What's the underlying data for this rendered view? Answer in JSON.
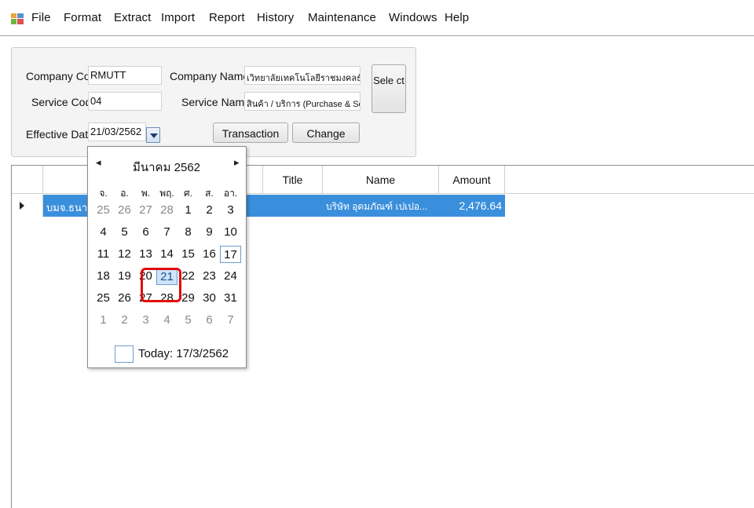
{
  "menu": {
    "items": [
      "File",
      "Format",
      "Extract",
      "Import",
      "Report",
      "History",
      "Maintenance",
      "Windows",
      "Help"
    ]
  },
  "header_panel": {
    "company_code_label": "Company Code",
    "company_code_value": "RMUTT",
    "company_name_label": "Company Name:",
    "company_name_value": "เวิทยาลัยเทคโนโลยีราชมงคลธัญบุรี",
    "service_code_label": "Service Code",
    "service_code_value": "04",
    "service_name_label": "Service Name:",
    "service_name_value": "สินค้า / บริการ (Purchase & Service)",
    "effective_date_label": "Effective Date",
    "effective_date_value": "21/03/2562",
    "select_button": "Sele ct",
    "transaction_button": "Transaction",
    "change_button": "Change"
  },
  "grid": {
    "columns": [
      "",
      "Title",
      "Name",
      "Amount"
    ],
    "rows": [
      {
        "col1": "บมจ.ธนาคาร",
        "title": "",
        "name": "บริษัท อุดมภัณฑ์ เปเปอ...",
        "amount": "2,476.64"
      }
    ]
  },
  "calendar": {
    "prev_label": "◂",
    "next_label": "▸",
    "month_title": "มีนาคม 2562",
    "weekdays": [
      "จ.",
      "อ.",
      "พ.",
      "พฤ.",
      "ศ.",
      "ส.",
      "อา."
    ],
    "weeks": [
      [
        "25",
        "26",
        "27",
        "28",
        "1",
        "2",
        "3"
      ],
      [
        "4",
        "5",
        "6",
        "7",
        "8",
        "9",
        "10"
      ],
      [
        "11",
        "12",
        "13",
        "14",
        "15",
        "16",
        "17"
      ],
      [
        "18",
        "19",
        "20",
        "21",
        "22",
        "23",
        "24"
      ],
      [
        "25",
        "26",
        "27",
        "28",
        "29",
        "30",
        "31"
      ],
      [
        "1",
        "2",
        "3",
        "4",
        "5",
        "6",
        "7"
      ]
    ],
    "selected_day": "21",
    "today_day": "17",
    "today_label": "Today: 17/3/2562"
  },
  "colors": {
    "row_highlight": "#3a8fdc",
    "selection_ring": "#e00c0c",
    "selected_day_bg": "#cfe3fa"
  }
}
